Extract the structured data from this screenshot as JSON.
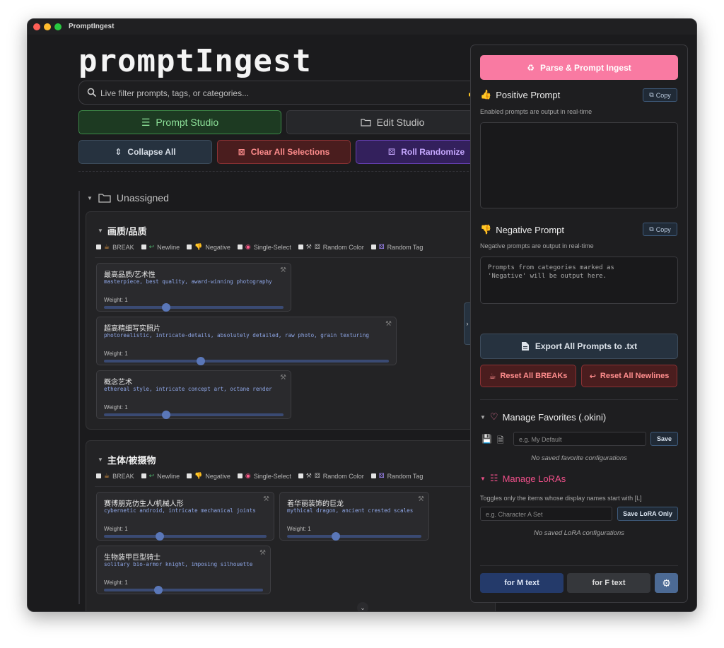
{
  "window": {
    "title": "PromptIngest"
  },
  "app": {
    "logo": "promptIngest"
  },
  "search": {
    "placeholder": "Live filter prompts, tags, or categories..."
  },
  "tabs": {
    "prompt_studio": "Prompt Studio",
    "edit_studio": "Edit Studio"
  },
  "actions": {
    "collapse_all": "Collapse All",
    "clear_all": "Clear All Selections",
    "roll_randomize": "Roll Randomize"
  },
  "folder": {
    "label": "Unassigned"
  },
  "option_labels": {
    "break": "BREAK",
    "newline": "Newline",
    "negative": "Negative",
    "single_select": "Single-Select",
    "random_color": "Random Color",
    "random_tag": "Random Tag"
  },
  "categories": [
    {
      "title": "画质/品质",
      "cards": [
        {
          "name": "最高品质/艺术性",
          "tags": "masterpiece, best quality, award-winning photography",
          "weight": "Weight: 1"
        },
        {
          "name": "超高精细写实照片",
          "tags": "photorealistic, intricate-details, absolutely detailed, raw photo, grain texturing",
          "weight": "Weight: 1"
        },
        {
          "name": "概念艺术",
          "tags": "ethereal style, intricate concept art, octane render",
          "weight": "Weight: 1"
        }
      ]
    },
    {
      "title": "主体/被摄物",
      "cards": [
        {
          "name": "赛博朋克仿生人/机械人形",
          "tags": "cybernetic android, intricate mechanical joints",
          "weight": "Weight: 1"
        },
        {
          "name": "着华丽装饰的巨龙",
          "tags": "mythical dragon, ancient crested scales",
          "weight": "Weight: 1"
        },
        {
          "name": "生物装甲巨型骑士",
          "tags": "solitary bio-armor knight, imposing silhouette",
          "weight": "Weight: 1"
        }
      ]
    }
  ],
  "panel": {
    "parse_button": "Parse & Prompt Ingest",
    "positive": {
      "title": "Positive Prompt",
      "copy": "Copy",
      "subtitle": "Enabled prompts are output in real-time",
      "value": ""
    },
    "negative": {
      "title": "Negative Prompt",
      "copy": "Copy",
      "subtitle": "Negative prompts are output in real-time",
      "placeholder": "Prompts from categories marked as 'Negative' will be output here."
    },
    "export": "Export All Prompts to .txt",
    "reset_breaks": "Reset All BREAKs",
    "reset_newlines": "Reset All Newlines",
    "favorites": {
      "title": "Manage Favorites (.okini)",
      "placeholder": "e.g. My Default",
      "save": "Save",
      "empty": "No saved favorite configurations"
    },
    "loras": {
      "title": "Manage LoRAs",
      "subtitle": "Toggles only the items whose display names start with [L]",
      "placeholder": "e.g. Character A Set",
      "save": "Save LoRA Only",
      "empty": "No saved LoRA configurations"
    },
    "footer": {
      "m_text": "for M text",
      "f_text": "for F text"
    }
  },
  "colors": {
    "accent_pink": "#f97aa2",
    "green": "#3d8a48",
    "red": "#8b3234",
    "purple": "#6740b3",
    "slider": "#5a77b8",
    "tag_text": "#8ea6e6"
  },
  "weights": [
    1,
    1,
    1,
    1,
    1,
    1
  ]
}
